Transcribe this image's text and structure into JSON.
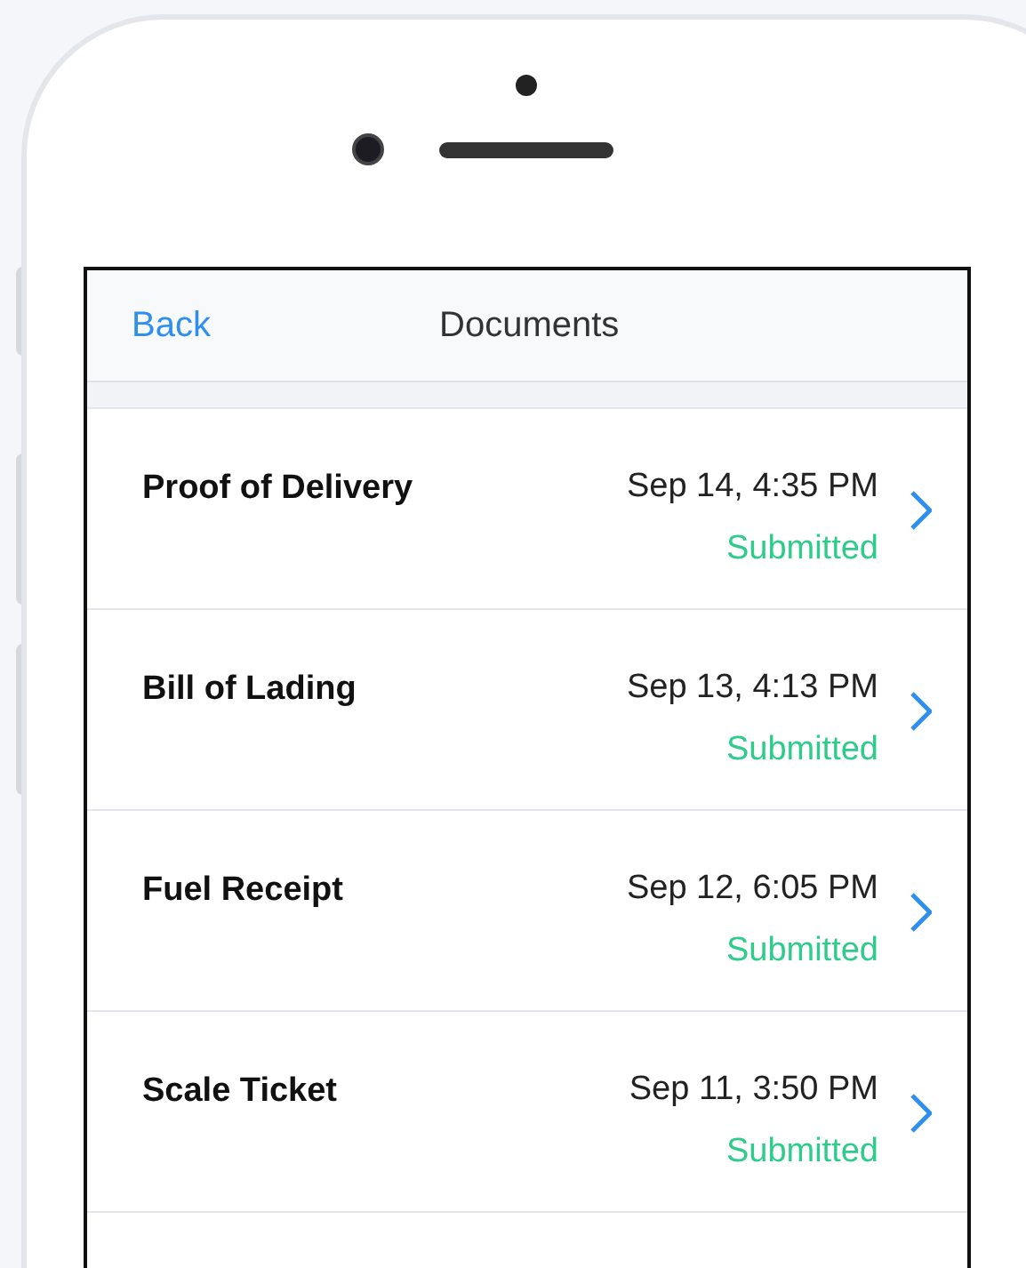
{
  "nav": {
    "back": "Back",
    "title": "Documents"
  },
  "documents": [
    {
      "name": "Proof of Delivery",
      "date": "Sep 14, 4:35 PM",
      "status": "Submitted"
    },
    {
      "name": "Bill of Lading",
      "date": "Sep 13, 4:13 PM",
      "status": "Submitted"
    },
    {
      "name": "Fuel Receipt",
      "date": "Sep 12, 6:05 PM",
      "status": "Submitted"
    },
    {
      "name": "Scale Ticket",
      "date": "Sep 11, 3:50 PM",
      "status": "Submitted"
    }
  ]
}
